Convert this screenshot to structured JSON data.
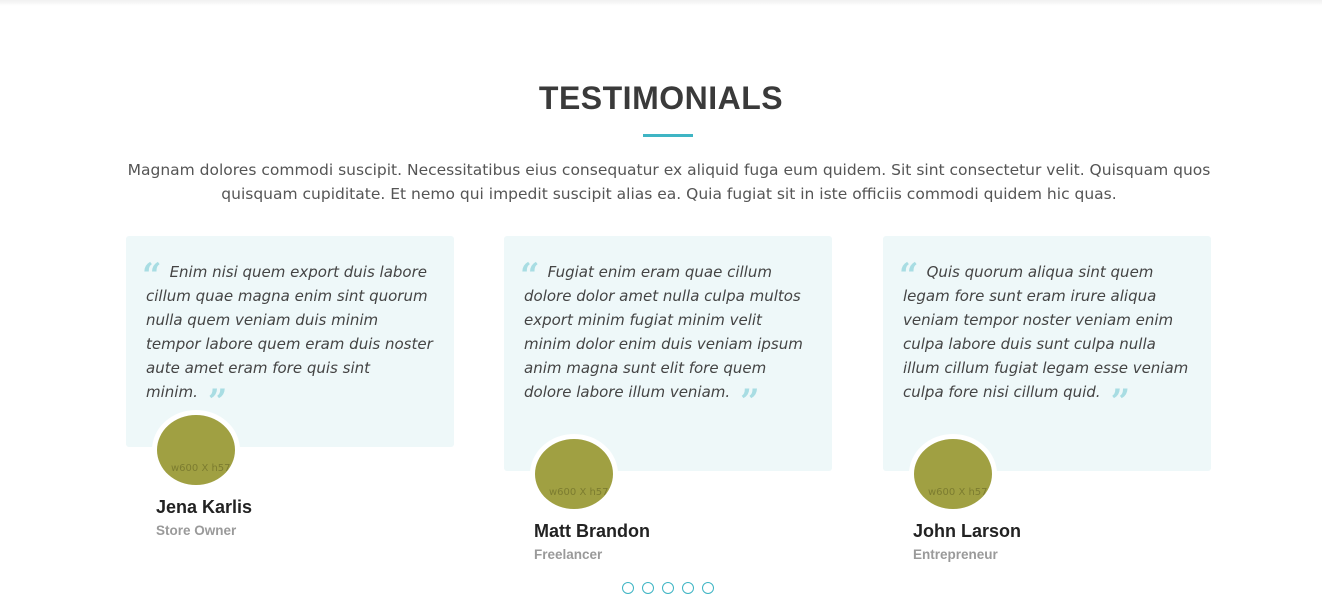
{
  "section": {
    "title": "TESTIMONIALS",
    "intro": "Magnam dolores commodi suscipit. Necessitatibus eius consequatur ex aliquid fuga eum quidem. Sit sint consectetur velit. Quisquam quos quisquam cupiditate. Et nemo qui impedit suscipit alias ea. Quia fugiat sit in iste officiis commodi quidem hic quas."
  },
  "colors": {
    "accent": "#3fb5c4",
    "card_background": "#eef8f9",
    "quote_icon": "#a8dde3",
    "avatar_placeholder": "#a0a042"
  },
  "icons": {
    "open_quote": "quote-left-icon",
    "close_quote": "quote-right-icon"
  },
  "testimonials": [
    {
      "quote": "Enim nisi quem export duis labore cillum quae magna enim sint quorum nulla quem veniam duis minim tempor labore quem eram duis noster aute amet eram fore quis sint minim.",
      "name": "Jena Karlis",
      "role": "Store Owner",
      "avatar_text": "w600 X h57"
    },
    {
      "quote": "Fugiat enim eram quae cillum dolore dolor amet nulla culpa multos export minim fugiat minim velit minim dolor enim duis veniam ipsum anim magna sunt elit fore quem dolore labore illum veniam.",
      "name": "Matt Brandon",
      "role": "Freelancer",
      "avatar_text": "w600 X h57"
    },
    {
      "quote": "Quis quorum aliqua sint quem legam fore sunt eram irure aliqua veniam tempor noster veniam enim culpa labore duis sunt culpa nulla illum cillum fugiat legam esse veniam culpa fore nisi cillum quid.",
      "name": "John Larson",
      "role": "Entrepreneur",
      "avatar_text": "w600 X h57"
    }
  ],
  "pagination": {
    "total": 5,
    "active": 1
  }
}
